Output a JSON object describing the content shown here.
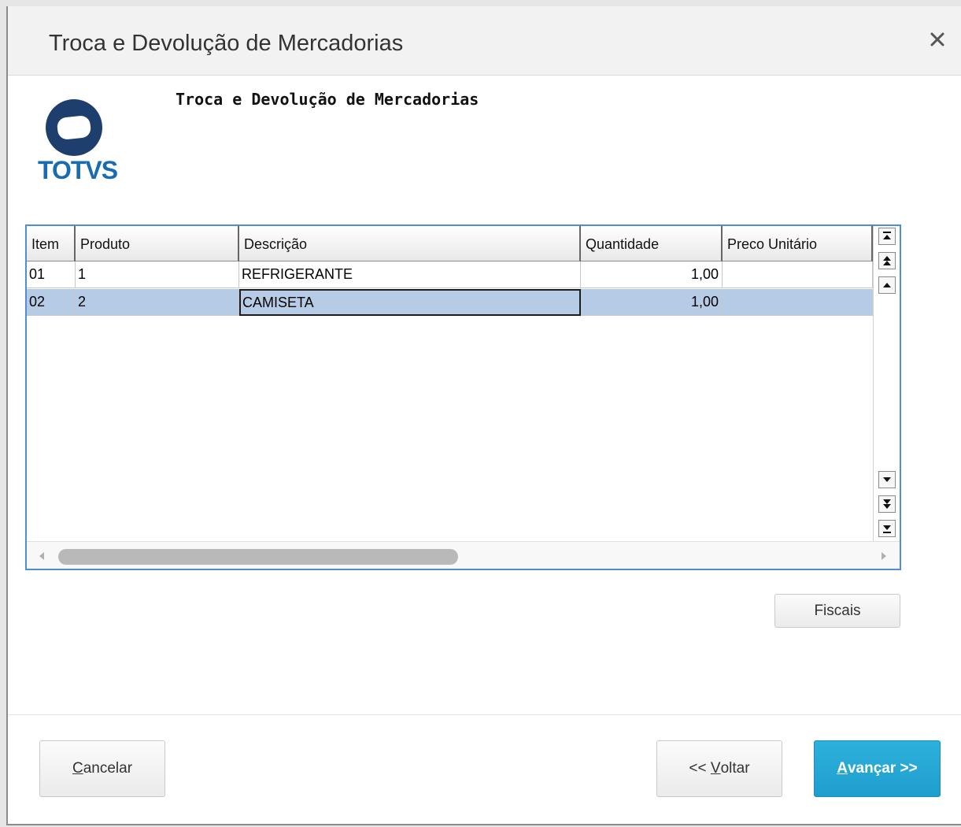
{
  "dialog": {
    "title": "Troca e Devolução de Mercadorias",
    "close_label": "×"
  },
  "header": {
    "logo_text": "TOTVS",
    "title": "Troca e Devolução de Mercadorias"
  },
  "grid": {
    "columns": [
      "Item",
      "Produto",
      "Descrição",
      "Quantidade",
      "Preco Unitário"
    ],
    "rows": [
      {
        "item": "01",
        "produto": "1",
        "descricao": "REFRIGERANTE",
        "quantidade": "1,00",
        "preco": ""
      },
      {
        "item": "02",
        "produto": "2",
        "descricao": "CAMISETA",
        "quantidade": "1,00",
        "preco": ""
      }
    ],
    "selected_row": 1,
    "selection_color": "#b6cce6",
    "border_color": "#4f8ed6"
  },
  "buttons": {
    "fiscais": "Fiscais",
    "cancel_accel": "C",
    "cancel_rest": "ancelar",
    "back_prefix": "<< ",
    "back_accel": "V",
    "back_rest": "oltar",
    "next_accel": "A",
    "next_rest": "vançar >>",
    "next_color": "#25a6d4"
  },
  "icons": {
    "close": "close-icon",
    "scroll": [
      "scroll-top-icon",
      "scroll-page-up-icon",
      "scroll-up-icon",
      "scroll-down-icon",
      "scroll-page-down-icon",
      "scroll-bottom-icon",
      "scroll-left-icon",
      "scroll-right-icon"
    ]
  }
}
